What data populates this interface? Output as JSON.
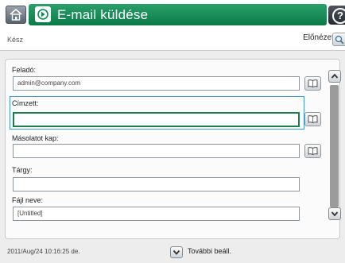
{
  "header": {
    "title": "E-mail küldése"
  },
  "status": {
    "text": "Kész",
    "preview_label": "Előnézet"
  },
  "form": {
    "from_label": "Feladó:",
    "from_value": "admin@company.com",
    "to_label": "Címzett:",
    "to_value": "",
    "cc_label": "Másolatot kap:",
    "cc_value": "",
    "subject_label": "Tárgy:",
    "subject_value": "",
    "filename_label": "Fájl neve:",
    "filename_value": "[Untitled]"
  },
  "footer": {
    "datetime": "2011/Aug/24 10:16:25 de.",
    "more_label": "További beáll."
  },
  "colors": {
    "accent": "#0f8a52",
    "focus": "#3d95d7"
  },
  "icons": [
    "home-icon",
    "email-icon",
    "help-icon",
    "preview-icon",
    "address-book-icon",
    "scroll-up-icon",
    "scroll-down-icon",
    "chevron-down-icon"
  ]
}
